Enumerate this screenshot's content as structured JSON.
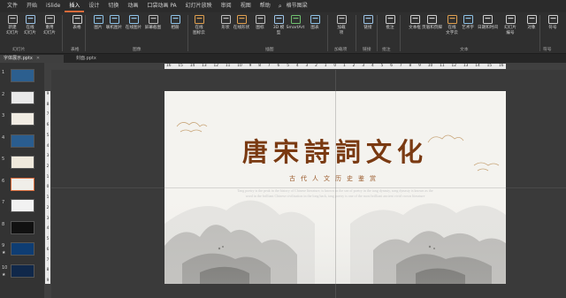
{
  "menu": {
    "items": [
      "文件",
      "开始",
      "iSlide",
      "插入",
      "设计",
      "切换",
      "动画",
      "口袋动画 PA",
      "幻灯片放映",
      "审阅",
      "视图",
      "帮助",
      "格节图梁"
    ],
    "active_index": 3
  },
  "ribbon": {
    "buttons": [
      {
        "label": "新建\n幻灯片",
        "icon": "new-slide-icon"
      },
      {
        "label": "在线\n幻灯片",
        "icon": "online-slide-icon"
      },
      {
        "label": "重用\n幻灯片",
        "icon": "reuse-slide-icon"
      },
      {
        "label": "表格",
        "icon": "table-icon"
      },
      {
        "label": "图片",
        "icon": "picture-icon"
      },
      {
        "label": "联机图片",
        "icon": "online-picture-icon"
      },
      {
        "label": "在线图片",
        "icon": "web-picture-icon"
      },
      {
        "label": "屏幕截图",
        "icon": "screenshot-icon"
      },
      {
        "label": "相册",
        "icon": "album-icon"
      },
      {
        "label": "在线\n图标云",
        "icon": "icon-cloud-icon"
      },
      {
        "label": "形状",
        "icon": "shapes-icon"
      },
      {
        "label": "在线形状",
        "icon": "online-shapes-icon"
      },
      {
        "label": "图标",
        "icon": "icons-icon"
      },
      {
        "label": "3D 模\n型",
        "icon": "3d-model-icon"
      },
      {
        "label": "SmartArt",
        "icon": "smartart-icon"
      },
      {
        "label": "图表",
        "icon": "chart-icon"
      },
      {
        "label": "加载\n项",
        "icon": "addins-icon"
      },
      {
        "label": "链接",
        "icon": "link-icon"
      },
      {
        "label": "批注",
        "icon": "comment-icon"
      },
      {
        "label": "文本框",
        "icon": "textbox-icon"
      },
      {
        "label": "页眉和页脚",
        "icon": "header-footer-icon"
      },
      {
        "label": "在线\n文字云",
        "icon": "word-cloud-icon"
      },
      {
        "label": "艺术字",
        "icon": "wordart-icon"
      },
      {
        "label": "日期和时间",
        "icon": "datetime-icon"
      },
      {
        "label": "幻灯片\n编号",
        "icon": "slide-number-icon"
      },
      {
        "label": "对象",
        "icon": "object-icon"
      },
      {
        "label": "符号",
        "icon": "symbol-icon"
      }
    ],
    "groups": [
      "幻灯片",
      "表格",
      "图像",
      "插图",
      "加载项",
      "链接",
      "批注",
      "文本",
      "符号"
    ]
  },
  "tabs": [
    {
      "label": "字体展示.pptx",
      "close": "✕"
    },
    {
      "label": "封面.pptx",
      "close": ""
    }
  ],
  "rulers": {
    "h": [
      "16",
      "15",
      "14",
      "13",
      "12",
      "11",
      "10",
      "9",
      "8",
      "7",
      "6",
      "5",
      "4",
      "3",
      "2",
      "1",
      "0",
      "1",
      "2",
      "3",
      "4",
      "5",
      "6",
      "7",
      "8",
      "9",
      "10",
      "11",
      "12",
      "13",
      "14",
      "15",
      "16"
    ],
    "v": [
      "9",
      "8",
      "7",
      "6",
      "5",
      "4",
      "3",
      "2",
      "1",
      "0",
      "1",
      "2",
      "3",
      "4",
      "5",
      "6",
      "7",
      "8",
      "9"
    ]
  },
  "thumbnails": [
    {
      "num": "1",
      "star": "",
      "bg": "#2c5f8f"
    },
    {
      "num": "2",
      "star": "",
      "bg": "#e9e9e9"
    },
    {
      "num": "3",
      "star": "",
      "bg": "#f1ece3"
    },
    {
      "num": "4",
      "star": "",
      "bg": "#2a5d8f"
    },
    {
      "num": "5",
      "star": "",
      "bg": "#efe9dc"
    },
    {
      "num": "6",
      "star": "",
      "bg": "#f0eee9"
    },
    {
      "num": "7",
      "star": "",
      "bg": "#f2f2f2"
    },
    {
      "num": "8",
      "star": "",
      "bg": "#111111"
    },
    {
      "num": "9",
      "star": "★",
      "bg": "#0e3d73"
    },
    {
      "num": "10",
      "star": "★",
      "bg": "#10284a"
    }
  ],
  "slide": {
    "title": "唐宋詩詞文化",
    "subtitle": "古代人文历史鉴赏",
    "body": "Tang poetry is the peak in the history of Chinese literature, is known as the sea of poetry in the tang dynasty, song dynasty is known as the word in the brilliant Chinese civilization in the long back, tang poetry is one of the most brilliant ancient vivid crown literature"
  },
  "colors": {
    "accent": "#d96b3a",
    "title": "#7a3a12",
    "subtitle": "#9a5a2a"
  }
}
